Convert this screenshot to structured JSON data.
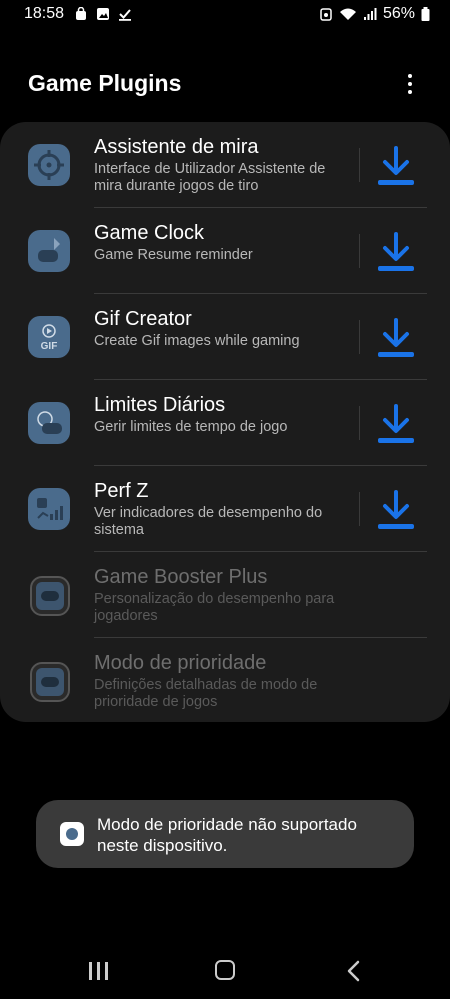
{
  "status": {
    "time": "18:58",
    "battery": "56%"
  },
  "header": {
    "title": "Game Plugins"
  },
  "plugins": [
    {
      "name": "Assistente de mira",
      "desc": "Interface de Utilizador Assistente de mira durante jogos de tiro",
      "icon": "crosshair-icon"
    },
    {
      "name": "Game Clock",
      "desc": "Game Resume reminder",
      "icon": "game-clock-icon"
    },
    {
      "name": "Gif Creator",
      "desc": "Create Gif images while gaming",
      "icon": "gif-icon"
    },
    {
      "name": "Limites Diários",
      "desc": "Gerir limites de tempo de jogo",
      "icon": "gamepad-limit-icon"
    },
    {
      "name": "Perf Z",
      "desc": "Ver indicadores de desempenho do sistema",
      "icon": "performance-icon"
    },
    {
      "name": "Game Booster Plus",
      "desc": "Personalização do desempenho para jogadores",
      "icon": "gamepad-icon"
    },
    {
      "name": "Modo de prioridade",
      "desc": "Definições detalhadas de modo de prioridade de jogos",
      "icon": "gamepad-icon"
    }
  ],
  "toast": {
    "text": "Modo de prioridade não suportado neste dispositivo."
  },
  "colors": {
    "accent": "#1a73e8",
    "background": "#000000",
    "card": "#1c1c1c"
  }
}
